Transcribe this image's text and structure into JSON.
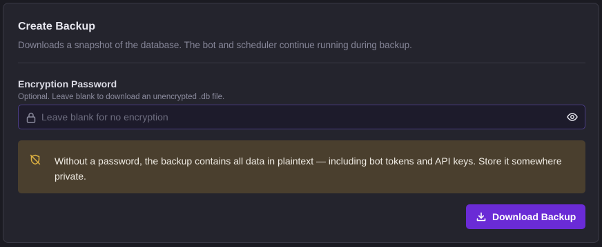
{
  "backup": {
    "title": "Create Backup",
    "subtitle": "Downloads a snapshot of the database. The bot and scheduler continue running during backup."
  },
  "encryption": {
    "label": "Encryption Password",
    "help": "Optional. Leave blank to download an unencrypted .db file.",
    "value": "",
    "placeholder": "Leave blank for no encryption",
    "lock_icon": "lock-icon",
    "toggle_icon": "eye-icon"
  },
  "warning": {
    "icon": "shield-off-icon",
    "text": "Without a password, the backup contains all data in plaintext — including bot tokens and API keys. Store it somewhere private."
  },
  "actions": {
    "download_label": "Download Backup",
    "download_icon": "download-icon"
  },
  "colors": {
    "accent": "#6a2bd6",
    "warning_bg": "#4a3f2e",
    "warning_icon": "#e0b341",
    "card_bg": "#24242d"
  }
}
